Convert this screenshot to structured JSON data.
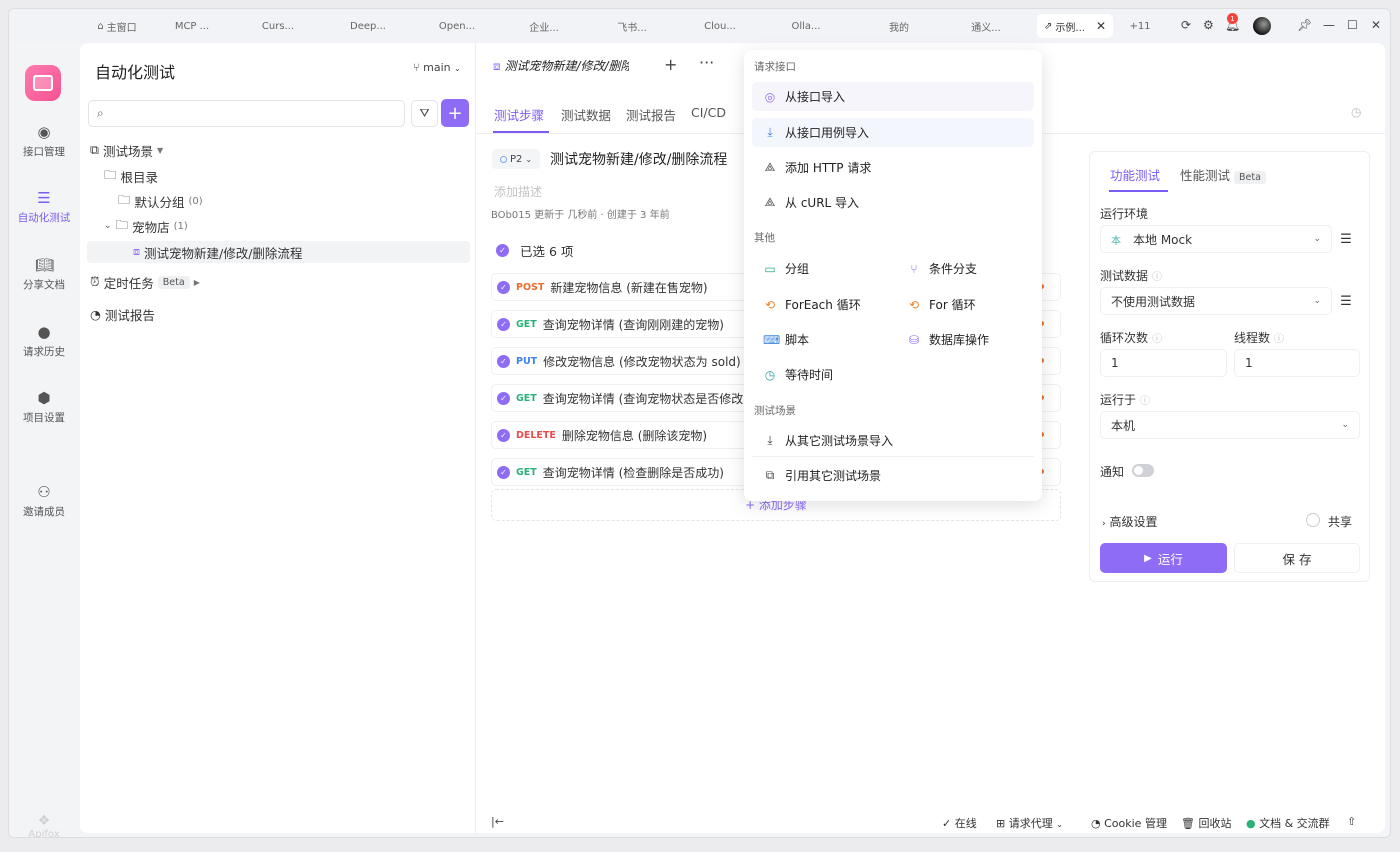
{
  "tabs": [
    {
      "label": "主窗口",
      "icon": "home-icon"
    },
    {
      "label": "MCP ..."
    },
    {
      "label": "Curs..."
    },
    {
      "label": "Deep..."
    },
    {
      "label": "Open..."
    },
    {
      "label": "企业..."
    },
    {
      "label": "飞书..."
    },
    {
      "label": "Clou..."
    },
    {
      "label": "Olla..."
    },
    {
      "label": "我的"
    },
    {
      "label": "通义..."
    },
    {
      "label": "示例...",
      "icon": "share-icon",
      "active": true
    },
    {
      "label": "+11"
    }
  ],
  "notification_count": "1",
  "rail": [
    {
      "label": "接口管理",
      "icon": "api-icon"
    },
    {
      "label": "自动化测试",
      "icon": "automation-icon",
      "active": true
    },
    {
      "label": "分享文档",
      "icon": "book-icon"
    },
    {
      "label": "请求历史",
      "icon": "clock-icon"
    },
    {
      "label": "项目设置",
      "icon": "settings-hex-icon"
    },
    {
      "label": "邀请成员",
      "icon": "add-user-icon"
    }
  ],
  "brand_watermark": "Apifox",
  "tree": {
    "title": "自动化测试",
    "branch": "main",
    "search_placeholder": "",
    "nodes": {
      "scenes": "测试场景",
      "root": "根目录",
      "default_group": "默认分组",
      "default_group_count": "(0)",
      "petstore": "宠物店",
      "petstore_count": "(1)",
      "scenario": "测试宠物新建/修改/删除流程",
      "scheduled": "定时任务",
      "scheduled_badge": "Beta",
      "reports": "测试报告"
    }
  },
  "scenario": {
    "tab_title": "测试宠物新建/修改/删除流程",
    "subtabs": [
      "测试步骤",
      "测试数据",
      "测试报告",
      "CI/CD"
    ],
    "priority": "P2",
    "title": "测试宠物新建/修改/删除流程",
    "description_placeholder": "添加描述",
    "meta": "BOb015 更新于 几秒前 · 创建于 3 年前",
    "selected": "已选 6 项",
    "steps": [
      {
        "method": "POST",
        "name": "新建宠物信息 (新建在售宠物)"
      },
      {
        "method": "GET",
        "name": "查询宠物详情 (查询刚刚建的宠物)"
      },
      {
        "method": "PUT",
        "name": "修改宠物信息 (修改宠物状态为 sold)"
      },
      {
        "method": "GET",
        "name": "查询宠物详情 (查询宠物状态是否修改"
      },
      {
        "method": "DELETE",
        "name": "删除宠物信息 (删除该宠物)"
      },
      {
        "method": "GET",
        "name": "查询宠物详情 (检查删除是否成功)"
      }
    ],
    "add_step": "+ 添加步骤"
  },
  "menu": {
    "sections": {
      "request": "请求接口",
      "other": "其他",
      "scene": "测试场景"
    },
    "request_items": [
      "从接口导入",
      "从接口用例导入",
      "添加 HTTP 请求",
      "从 cURL 导入"
    ],
    "other_items": [
      "分组",
      "条件分支",
      "ForEach 循环",
      "For 循环",
      "脚本",
      "数据库操作",
      "等待时间"
    ],
    "scene_items": [
      "从其它测试场景导入",
      "引用其它测试场景"
    ]
  },
  "settings": {
    "tabs": [
      "功能测试",
      "性能测试"
    ],
    "perf_badge": "Beta",
    "env_label": "运行环境",
    "env_prefix": "本",
    "env_value": "本地 Mock",
    "data_label": "测试数据",
    "data_value": "不使用测试数据",
    "loop_label": "循环次数",
    "loop_value": "1",
    "thread_label": "线程数",
    "thread_value": "1",
    "runon_label": "运行于",
    "runon_value": "本机",
    "notify_label": "通知",
    "advanced": "高级设置",
    "share": "共享",
    "run": "运行",
    "save": "保 存"
  },
  "statusbar": {
    "online": "在线",
    "proxy": "请求代理",
    "cookie": "Cookie 管理",
    "recycle": "回收站",
    "docs": "文档 & 交流群"
  },
  "colors": {
    "accent": "#8f6cf5",
    "post": "#e66e2f",
    "get": "#2cb07a",
    "put": "#3c7ff0",
    "delete": "#e64d4d"
  }
}
